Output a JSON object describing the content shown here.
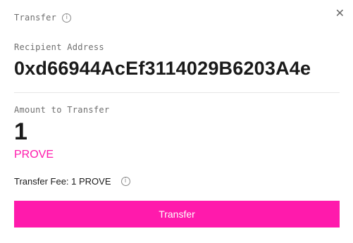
{
  "header": {
    "title": "Transfer",
    "info_icon": "info-icon"
  },
  "close_icon": "close-icon",
  "recipient": {
    "label": "Recipient Address",
    "value": "0xd66944AcEf3114029B6203A4e"
  },
  "amount": {
    "label": "Amount to Transfer",
    "value": "1",
    "unit": "PROVE"
  },
  "fee": {
    "text": "Transfer Fee: 1 PROVE",
    "info_icon": "info-icon"
  },
  "actions": {
    "transfer_label": "Transfer"
  },
  "colors": {
    "accent": "#ff1aac",
    "label_gray": "#6f6f6f",
    "text": "#1a1a1a",
    "divider": "#e6e6e6"
  }
}
